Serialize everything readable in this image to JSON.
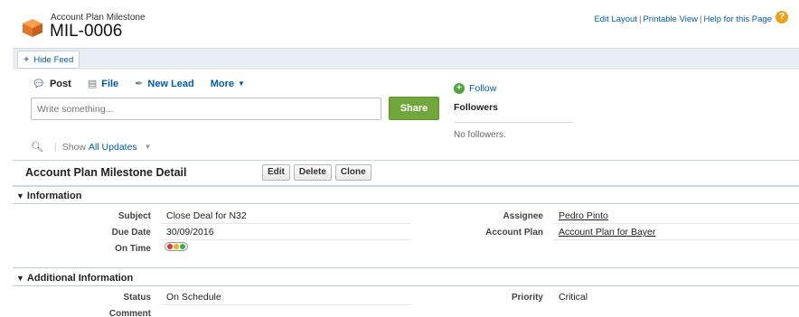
{
  "header": {
    "object_type": "Account Plan Milestone",
    "record_name": "MIL-0006",
    "links": [
      "Edit Layout",
      "Printable View",
      "Help for this Page"
    ],
    "help_icon": "?"
  },
  "feed": {
    "hide_feed_label": "Hide Feed",
    "tabs": [
      {
        "label": "Post",
        "icon": "chat-bubble-icon"
      },
      {
        "label": "File",
        "icon": "file-icon"
      },
      {
        "label": "New Lead",
        "icon": "pin-icon"
      },
      {
        "label": "More",
        "icon": "caret-down-icon"
      }
    ],
    "write_placeholder": "Write something...",
    "share_label": "Share",
    "show_label": "Show",
    "show_value": "All Updates",
    "follow_label": "Follow",
    "followers_title": "Followers",
    "no_followers": "No followers."
  },
  "detail": {
    "title": "Account Plan Milestone Detail",
    "buttons": {
      "edit": "Edit",
      "delete": "Delete",
      "clone": "Clone"
    },
    "sections": {
      "information": {
        "title": "Information",
        "subject_label": "Subject",
        "subject_value": "Close Deal for N32",
        "due_label": "Due Date",
        "due_value": "30/09/2016",
        "ontime_label": "On Time",
        "assignee_label": "Assignee",
        "assignee_value": "Pedro Pinto",
        "plan_label": "Account Plan",
        "plan_value": "Account Plan for Bayer"
      },
      "additional": {
        "title": "Additional Information",
        "status_label": "Status",
        "status_value": "On Schedule",
        "priority_label": "Priority",
        "priority_value": "Critical",
        "comment_label": "Comment"
      }
    }
  },
  "colors": {
    "link": "#015ba7",
    "share": "#71a63b",
    "help": "#e9a31a",
    "traffic_red": "#d9383a",
    "traffic_amber": "#e8b21c",
    "traffic_green": "#3fae3a"
  }
}
